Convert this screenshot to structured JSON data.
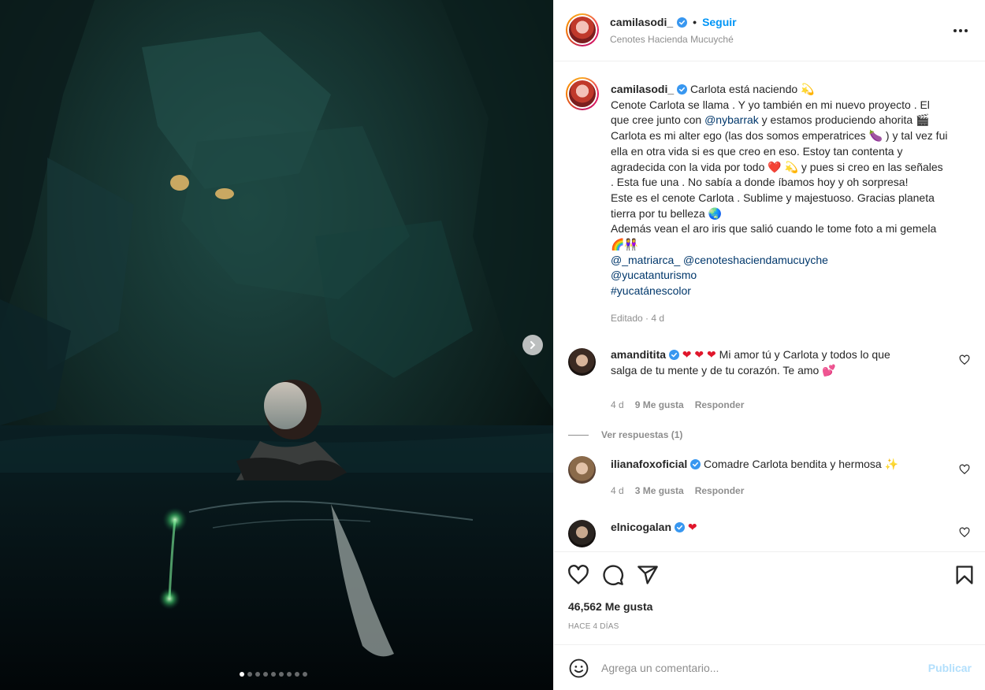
{
  "post": {
    "username": "camilasodi_",
    "separator": "•",
    "follow_label": "Seguir",
    "location": "Cenotes Hacienda Mucuyché",
    "more_icon": "more-options-icon"
  },
  "media": {
    "carousel_count": 9,
    "carousel_active": 1
  },
  "caption": {
    "username": "camilasodi_",
    "lines": [
      [
        "",
        "Carlota está naciendo 💫"
      ],
      [
        "Cenote Carlota se llama . Y yo también en mi nuevo proyecto . El"
      ],
      [
        "que cree junto con ",
        "@nybarrak",
        " y estamos produciendo ahorita 🎬"
      ],
      [
        "Carlota es mi alter ego (las dos somos emperatrices 🍆 ) y tal vez fui"
      ],
      [
        "ella en otra vida si es que creo en eso. Estoy tan contenta y"
      ],
      [
        "agradecida con la vida por todo ",
        "❤️",
        " 💫 y pues si creo en las señales"
      ],
      [
        ". Esta fue una . No sabía a donde íbamos hoy y oh sorpresa!"
      ],
      [
        "Este es el cenote Carlota . Sublime y majestuoso. Gracias planeta"
      ],
      [
        "tierra por tu belleza 🌏"
      ],
      [
        "Además vean el aro iris que salió cuando le tome foto a mi gemela"
      ],
      [
        "🌈👭"
      ]
    ],
    "tags_line1a": "@_matriarca_",
    "tags_line1b": "@cenoteshaciendamucuyche",
    "tags_line2": "@yucatanturismo",
    "hashtag": "#yucatánescolor",
    "edited": "Editado",
    "edited_sep": "·",
    "edited_time": "4 d"
  },
  "comments": [
    {
      "username": "amanditita",
      "hearts": "❤ ❤ ❤",
      "text_a": "Mi amor tú y Carlota y todos lo que",
      "text_b": "salga de tu mente y de tu corazón. Te amo 💕",
      "time": "4 d",
      "likes": "9 Me gusta",
      "reply": "Responder",
      "view_replies": "Ver respuestas (1)"
    },
    {
      "username": "ilianafoxoficial",
      "text": "Comadre Carlota bendita y hermosa ✨",
      "time": "4 d",
      "likes": "3 Me gusta",
      "reply": "Responder"
    },
    {
      "username": "elnicogalan",
      "text": "❤"
    }
  ],
  "actions": {
    "likes": "46,562 Me gusta",
    "time": "HACE 4 DÍAS"
  },
  "add_comment": {
    "placeholder": "Agrega un comentario...",
    "publish": "Publicar"
  },
  "colors": {
    "link": "#00376b",
    "accent": "#0095f6",
    "muted": "#8e8e8e",
    "verified": "#3897f0",
    "heart": "#e0162b"
  }
}
